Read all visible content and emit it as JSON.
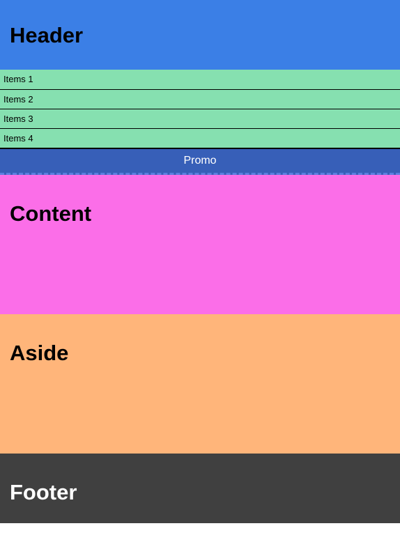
{
  "header": {
    "title": "Header"
  },
  "items": [
    {
      "label": "Items 1"
    },
    {
      "label": "Items 2"
    },
    {
      "label": "Items 3"
    },
    {
      "label": "Items 4"
    }
  ],
  "promo": {
    "label": "Promo"
  },
  "content": {
    "title": "Content"
  },
  "aside": {
    "title": "Aside"
  },
  "footer": {
    "title": "Footer"
  },
  "colors": {
    "header": "#3b7fe6",
    "items": "#86e0b0",
    "promo": "#375fb8",
    "content": "#fb6ee8",
    "aside": "#ffb57a",
    "footer": "#404040"
  }
}
